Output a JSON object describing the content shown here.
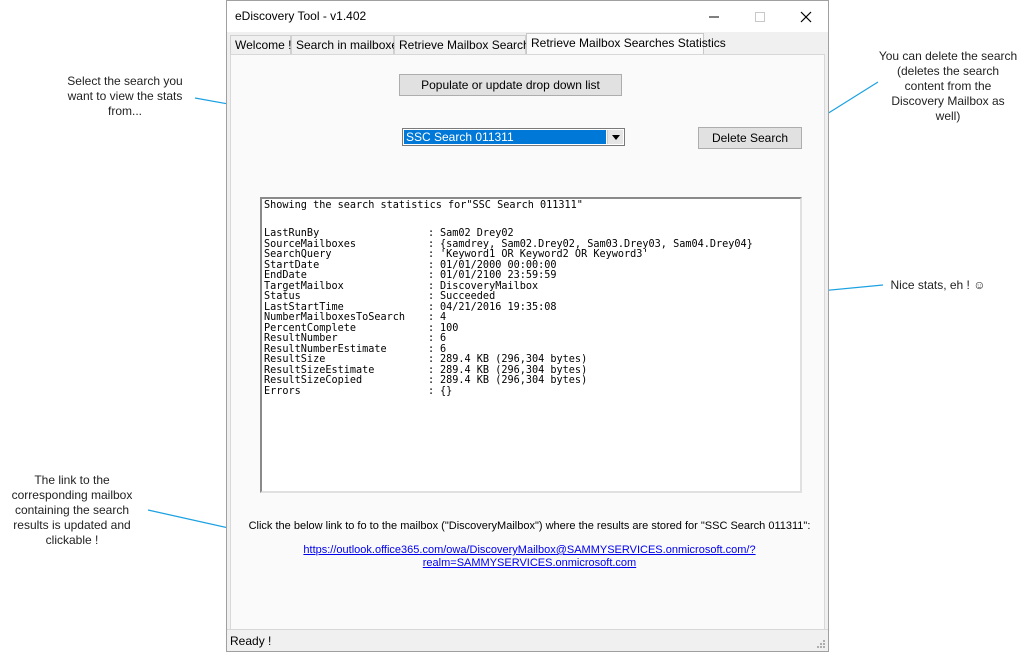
{
  "window": {
    "title": "eDiscovery Tool - v1.402"
  },
  "tabs": [
    "Welcome !",
    "Search in mailboxes",
    "Retrieve Mailbox Searches",
    "Retrieve Mailbox Searches Statistics"
  ],
  "controls": {
    "populate_button": "Populate or update drop down list",
    "search_select_value": "SSC Search 011311",
    "delete_button": "Delete Search"
  },
  "stats": {
    "heading": "Showing the search statistics for\"SSC Search 011311\"",
    "rows": [
      {
        "key": "LastRunBy",
        "value": "Sam02 Drey02"
      },
      {
        "key": "SourceMailboxes",
        "value": "{samdrey, Sam02.Drey02, Sam03.Drey03, Sam04.Drey04}"
      },
      {
        "key": "SearchQuery",
        "value": "'Keyword1 OR Keyword2 OR Keyword3'"
      },
      {
        "key": "StartDate",
        "value": "01/01/2000 00:00:00"
      },
      {
        "key": "EndDate",
        "value": "01/01/2100 23:59:59"
      },
      {
        "key": "TargetMailbox",
        "value": "DiscoveryMailbox"
      },
      {
        "key": "Status",
        "value": "Succeeded"
      },
      {
        "key": "LastStartTime",
        "value": "04/21/2016 19:35:08"
      },
      {
        "key": "NumberMailboxesToSearch",
        "value": "4"
      },
      {
        "key": "PercentComplete",
        "value": "100"
      },
      {
        "key": "ResultNumber",
        "value": "6"
      },
      {
        "key": "ResultNumberEstimate",
        "value": "6"
      },
      {
        "key": "ResultSize",
        "value": "289.4 KB (296,304 bytes)"
      },
      {
        "key": "ResultSizeEstimate",
        "value": "289.4 KB (296,304 bytes)"
      },
      {
        "key": "ResultSizeCopied",
        "value": "289.4 KB (296,304 bytes)"
      },
      {
        "key": "Errors",
        "value": "{}"
      }
    ],
    "separator": ":"
  },
  "mailbox_link": {
    "intro": "Click the below link to fo to the mailbox (\"DiscoveryMailbox\") where the results are stored for \"SSC Search 011311\":",
    "line1": "https://outlook.office365.com/owa/DiscoveryMailbox@SAMMYSERVICES.onmicrosoft.com/?",
    "line2": "realm=SAMMYSERVICES.onmicrosoft.com"
  },
  "statusbar": {
    "text": "Ready !"
  },
  "annotations": {
    "select_search": "Select the search you want to view the stats from...",
    "delete_search": "You can delete the search (deletes the search content from the Discovery Mailbox as well)",
    "nice_stats": "Nice stats, eh ! ☺",
    "link_note": "The link to the corresponding mailbox containing the search results is updated and clickable !"
  },
  "colors": {
    "arrow": "#1ba1e2",
    "link": "#0000ee",
    "selection": "#0078d7"
  }
}
